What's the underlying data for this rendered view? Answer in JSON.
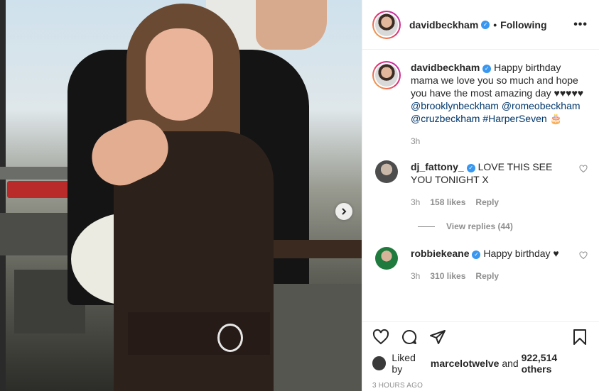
{
  "post": {
    "author": "davidbeckham",
    "follow_separator": "•",
    "follow_status": "Following",
    "more_label": "•••",
    "caption_parts": {
      "text": "Happy birthday mama we love you so much and hope you have the most amazing day ♥♥♥♥♥ ",
      "mention1": "@brooklynbeckham",
      "mention2": "@romeobeckham",
      "mention3": "@cruzbeckham",
      "hashtag": "#HarperSeven",
      "emoji": "🎂"
    },
    "caption_time": "3h"
  },
  "comments": [
    {
      "username": "dj_fattony_",
      "text": "LOVE THIS SEE YOU TONIGHT X",
      "time": "3h",
      "likes": "158 likes",
      "reply": "Reply",
      "view_replies": "View replies (44)"
    },
    {
      "username": "robbiekeane",
      "text": "Happy birthday ♥",
      "time": "3h",
      "likes": "310 likes",
      "reply": "Reply"
    }
  ],
  "footer": {
    "liked_prefix": "Liked by ",
    "liked_user": "marcelotwelve",
    "liked_mid": " and ",
    "liked_count": "922,514 others",
    "timestamp": "3 HOURS AGO"
  },
  "icons": {
    "like": "heart-icon",
    "comment": "comment-icon",
    "share": "share-icon",
    "save": "bookmark-icon",
    "verified": "verified-icon",
    "next": "chevron-right-icon"
  },
  "colors": {
    "verified": "#3897f0",
    "mention": "#00376b",
    "muted": "#8e8e8e",
    "text": "#262626"
  }
}
